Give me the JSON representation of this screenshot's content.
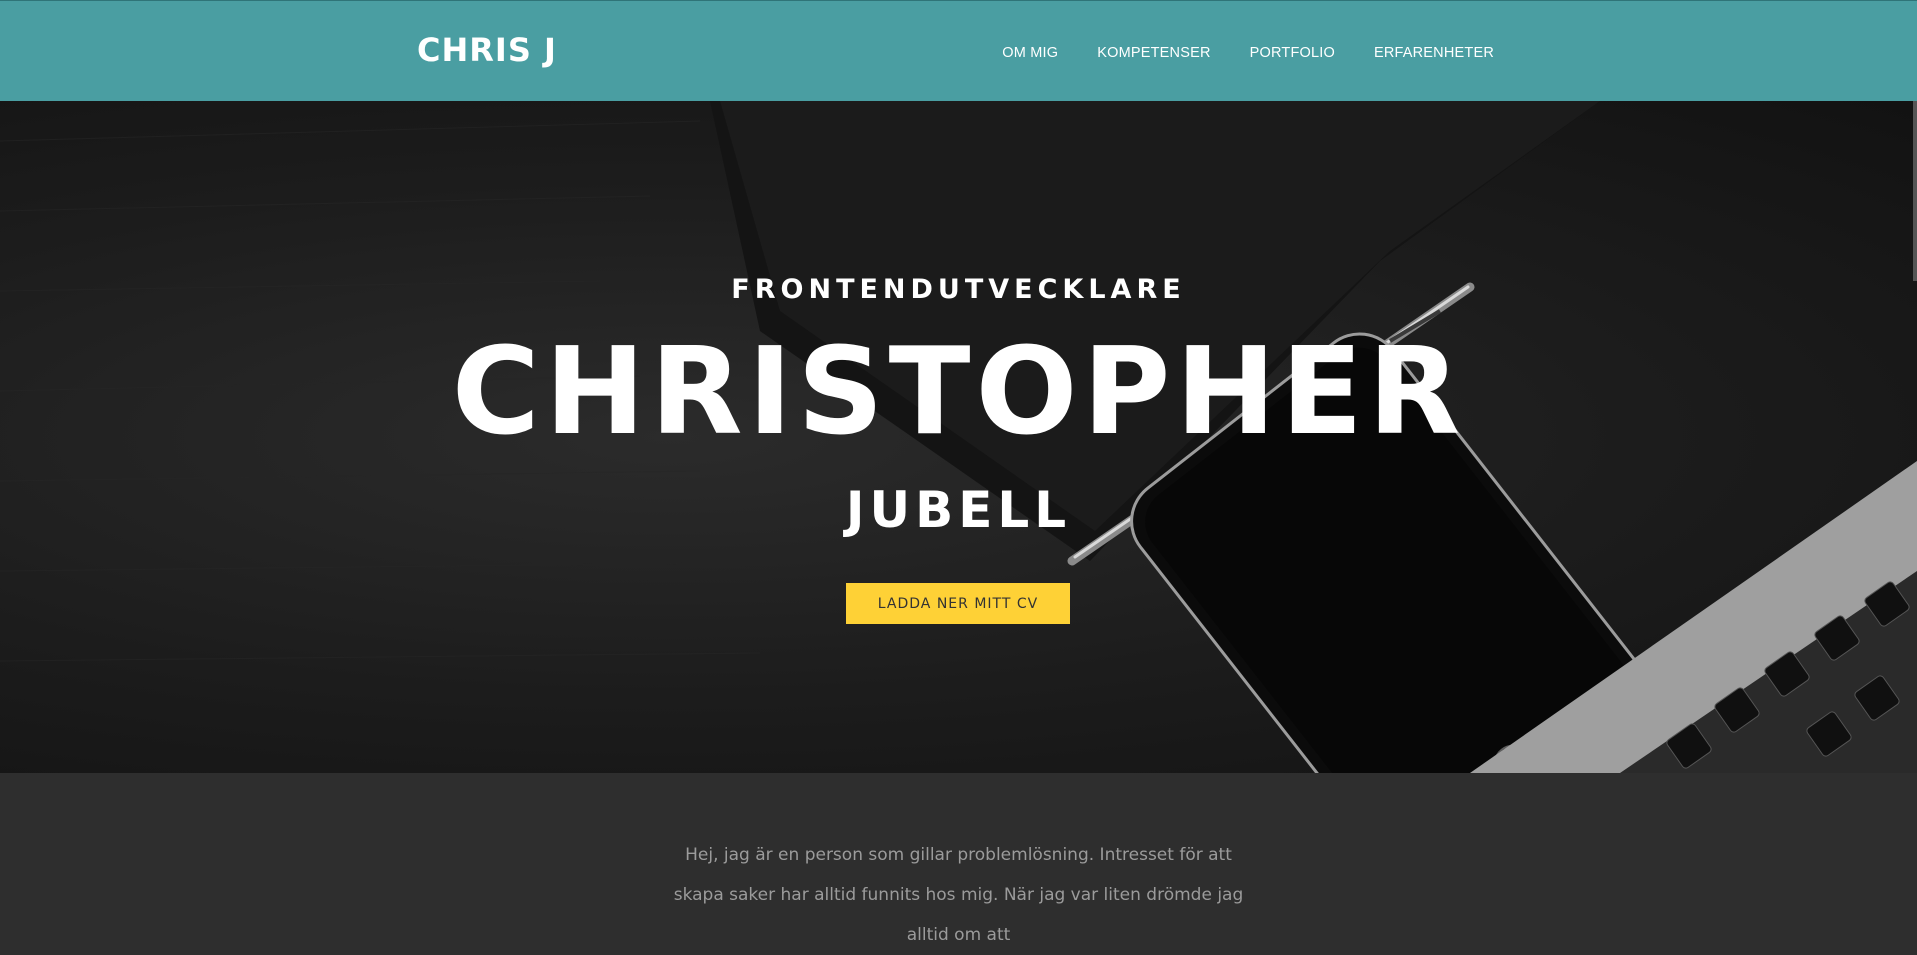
{
  "navbar": {
    "brand": "CHRIS J",
    "links": [
      "OM MIG",
      "KOMPETENSER",
      "PORTFOLIO",
      "ERFARENHETER"
    ]
  },
  "hero": {
    "kicker": "FRONTENDUTVECKLARE",
    "name": "CHRISTOPHER",
    "surname": "JUBELL",
    "button_label": "LADDA NER MITT CV"
  },
  "about": {
    "text": "Hej, jag är en person som gillar problemlösning. Intresset för att skapa saker har alltid funnits hos mig. När jag var liten drömde jag alltid om att"
  },
  "colors": {
    "navbar": "#4a9ea2",
    "accent_button": "#fed136",
    "body_background": "#2e2e2e"
  }
}
